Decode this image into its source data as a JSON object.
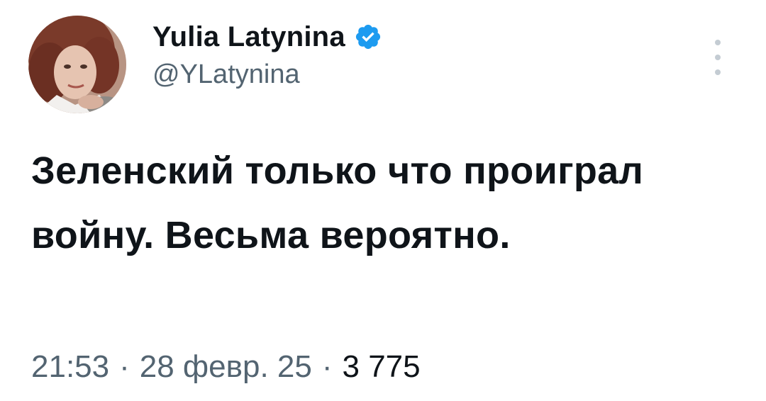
{
  "author": {
    "display_name": "Yulia Latynina",
    "handle": "@YLatynina",
    "verified_icon": "verified-badge-icon",
    "verified_color": "#1d9bf0"
  },
  "tweet": {
    "text": "Зеленский только что проиграл войну. Весьма вероятно."
  },
  "meta": {
    "time": "21:53",
    "separator": "·",
    "date": "28 февр. 25",
    "views": "3 775"
  },
  "icons": {
    "more": "more-options-icon"
  }
}
